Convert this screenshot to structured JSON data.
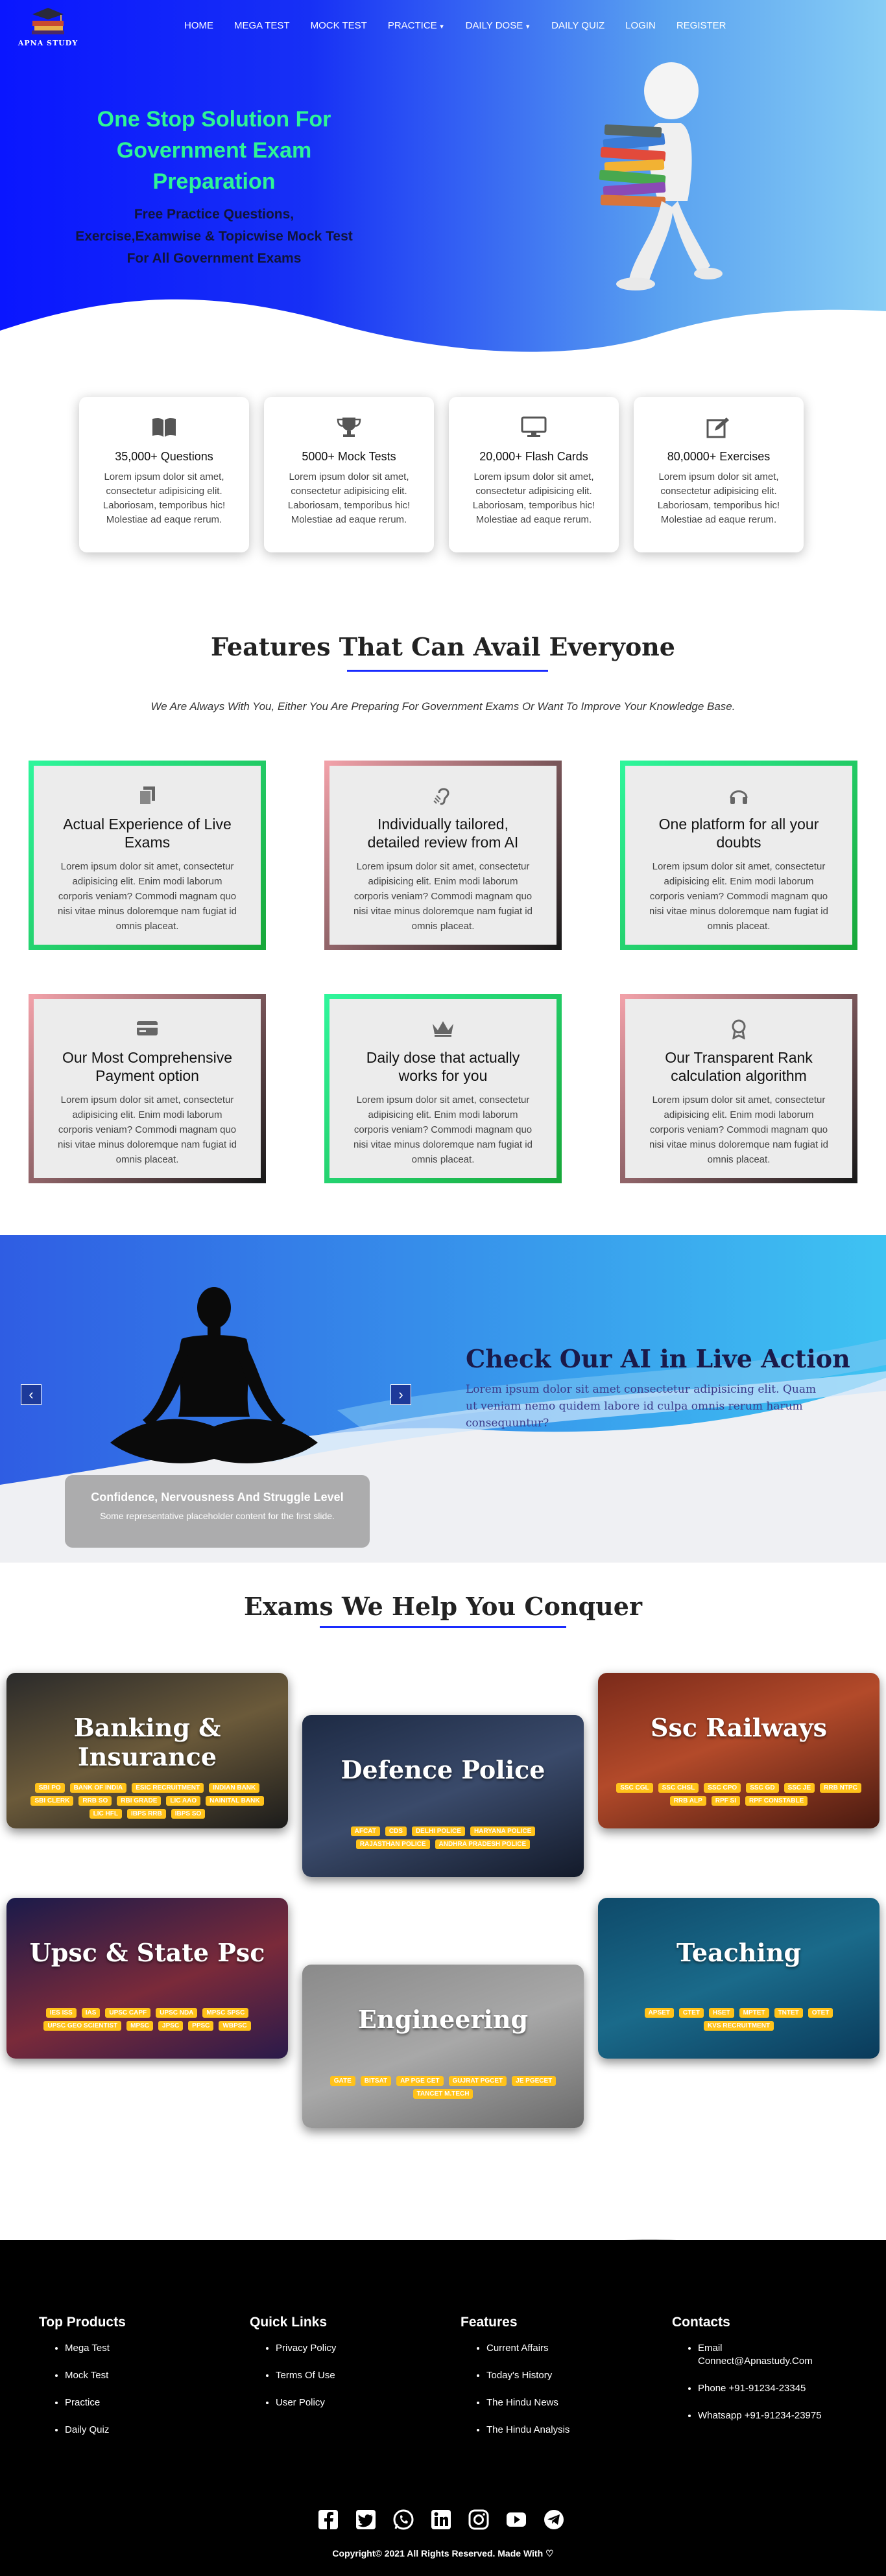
{
  "brand": {
    "name": "APNA STUDY"
  },
  "nav": {
    "items": [
      {
        "label": "HOME",
        "dropdown": false
      },
      {
        "label": "MEGA TEST",
        "dropdown": false
      },
      {
        "label": "MOCK TEST",
        "dropdown": false
      },
      {
        "label": "PRACTICE",
        "dropdown": true
      },
      {
        "label": "DAILY DOSE",
        "dropdown": true
      },
      {
        "label": "DAILY QUIZ",
        "dropdown": false
      },
      {
        "label": "LOGIN",
        "dropdown": false
      },
      {
        "label": "REGISTER",
        "dropdown": false
      }
    ]
  },
  "hero": {
    "title": "One Stop Solution For Government Exam Preparation",
    "subtitle": "Free Practice Questions, Exercise,Examwise & Topicwise Mock Test For All Government Exams"
  },
  "stats": [
    {
      "icon": "book-icon",
      "title": "35,000+ Questions",
      "text": "Lorem ipsum dolor sit amet, consectetur adipisicing elit. Laboriosam, temporibus hic! Molestiae ad eaque rerum."
    },
    {
      "icon": "trophy-icon",
      "title": "5000+ Mock Tests",
      "text": "Lorem ipsum dolor sit amet, consectetur adipisicing elit. Laboriosam, temporibus hic! Molestiae ad eaque rerum."
    },
    {
      "icon": "desktop-icon",
      "title": "20,000+ Flash Cards",
      "text": "Lorem ipsum dolor sit amet, consectetur adipisicing elit. Laboriosam, temporibus hic! Molestiae ad eaque rerum."
    },
    {
      "icon": "edit-icon",
      "title": "80,0000+ Exercises",
      "text": "Lorem ipsum dolor sit amet, consectetur adipisicing elit. Laboriosam, temporibus hic! Molestiae ad eaque rerum."
    }
  ],
  "features": {
    "title": "Features That Can Avail Everyone",
    "subtitle": "We Are Always With You, Either You Are Preparing For Government Exams Or Want To Improve Your Knowledge Base.",
    "cards": [
      {
        "icon": "copy-icon",
        "title": "Actual Experience of Live Exams",
        "text": "Lorem ipsum dolor sit amet, consectetur adipisicing elit. Enim modi laborum corporis veniam? Commodi magnam quo nisi vitae minus doloremque nam fugiat id omnis placeat."
      },
      {
        "icon": "assistive-listening-icon",
        "title": "Individually tailored, detailed review from AI",
        "text": "Lorem ipsum dolor sit amet, consectetur adipisicing elit. Enim modi laborum corporis veniam? Commodi magnam quo nisi vitae minus doloremque nam fugiat id omnis placeat."
      },
      {
        "icon": "headphones-icon",
        "title": "One platform for all your doubts",
        "text": "Lorem ipsum dolor sit amet, consectetur adipisicing elit. Enim modi laborum corporis veniam? Commodi magnam quo nisi vitae minus doloremque nam fugiat id omnis placeat."
      },
      {
        "icon": "credit-card-icon",
        "title": "Our Most Comprehensive Payment option",
        "text": "Lorem ipsum dolor sit amet, consectetur adipisicing elit. Enim modi laborum corporis veniam? Commodi magnam quo nisi vitae minus doloremque nam fugiat id omnis placeat."
      },
      {
        "icon": "crown-icon",
        "title": "Daily dose that actually works for you",
        "text": "Lorem ipsum dolor sit amet, consectetur adipisicing elit. Enim modi laborum corporis veniam? Commodi magnam quo nisi vitae minus doloremque nam fugiat id omnis placeat."
      },
      {
        "icon": "award-icon",
        "title": "Our Transparent Rank calculation algorithm",
        "text": "Lorem ipsum dolor sit amet, consectetur adipisicing elit. Enim modi laborum corporis veniam? Commodi magnam quo nisi vitae minus doloremque nam fugiat id omnis placeat."
      }
    ]
  },
  "ai": {
    "title": "Check Our AI in Live Action",
    "text": "Lorem ipsum dolor sit amet consectetur adipisicing elit. Quam ut veniam nemo quidem labore id culpa omnis rerum harum consequuntur?",
    "caption_title": "Confidence, Nervousness And Struggle Level",
    "caption_text": "Some representative placeholder content for the first slide.",
    "prev_icon": "chevron-left-icon",
    "next_icon": "chevron-right-icon"
  },
  "exams": {
    "title": "Exams We Help You Conquer",
    "cards": [
      {
        "title": "Banking & Insurance",
        "tags": [
          "SBI PO",
          "BANK OF INDIA",
          "ESIC RECRUITMENT",
          "INDIAN BANK",
          "SBI CLERK",
          "RRB SO",
          "RBI GRADE",
          "LIC AAO",
          "NAINITAL BANK",
          "LIC HFL",
          "IBPS RRB",
          "IBPS SO"
        ]
      },
      {
        "title": "Defence Police",
        "tags": [
          "AFCAT",
          "CDS",
          "DELHI POLICE",
          "HARYANA POLICE",
          "RAJASTHAN POLICE",
          "ANDHRA PRADESH POLICE"
        ]
      },
      {
        "title": "Ssc Railways",
        "tags": [
          "SSC CGL",
          "SSC CHSL",
          "SSC CPO",
          "SSC GD",
          "SSC JE",
          "RRB NTPC",
          "RRB ALP",
          "RPF SI",
          "RPF CONSTABLE"
        ]
      },
      {
        "title": "Upsc & State Psc",
        "tags": [
          "IES ISS",
          "IAS",
          "UPSC CAPF",
          "UPSC NDA",
          "MPSC SPSC",
          "UPSC GEO SCIENTIST",
          "MPSC",
          "JPSC",
          "PPSC",
          "WBPSC"
        ]
      },
      {
        "title": "Engineering",
        "tags": [
          "GATE",
          "BITSAT",
          "AP PGE CET",
          "GUJRAT PGCET",
          "JE PGECET",
          "TANCET M.TECH"
        ]
      },
      {
        "title": "Teaching",
        "tags": [
          "APSET",
          "CTET",
          "HSET",
          "MPTET",
          "TNTET",
          "OTET",
          "KVS RECRUITMENT"
        ]
      }
    ]
  },
  "footer": {
    "columns": [
      {
        "title": "Top Products",
        "items": [
          "Mega Test",
          "Mock Test",
          "Practice",
          "Daily Quiz"
        ]
      },
      {
        "title": "Quick Links",
        "items": [
          "Privacy Policy",
          "Terms Of Use",
          "User Policy"
        ]
      },
      {
        "title": "Features",
        "items": [
          "Current Affairs",
          "Today's History",
          "The Hindu News",
          "The Hindu Analysis"
        ]
      },
      {
        "title": "Contacts",
        "items": [
          "Email Connect@Apnastudy.Com",
          "Phone +91-91234-23345",
          "Whatsapp +91-91234-23975"
        ]
      }
    ],
    "social": [
      "facebook-icon",
      "twitter-icon",
      "whatsapp-icon",
      "linkedin-icon",
      "instagram-icon",
      "youtube-icon",
      "telegram-icon"
    ],
    "copyright": "Copyright© 2021 All Rights Reserved. Made With ♡"
  },
  "colors": {
    "accent": "#1a2cff",
    "hero_title": "#2ef596",
    "tag": "#ffc21a",
    "card_green": "#18a83a"
  }
}
